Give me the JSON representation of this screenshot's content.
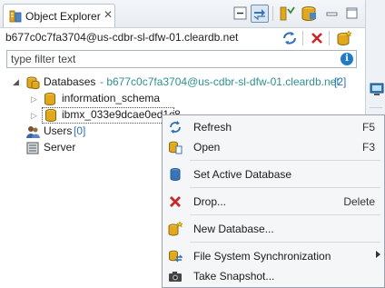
{
  "tab": {
    "title": "Object Explorer",
    "close": "✕"
  },
  "connection": {
    "label": "b677c0c7fa3704@us-cdbr-sl-dfw-01.cleardb.net"
  },
  "filter": {
    "placeholder": "type filter text",
    "info": "i"
  },
  "tree": {
    "databases": {
      "label": "Databases",
      "connection": "- b677c0c7fa3704@us-cdbr-sl-dfw-01.cleardb.net",
      "count": "[2]"
    },
    "schema1": {
      "label": "information_schema"
    },
    "schema2": {
      "label": "ibmx_033e9dcae0ed1c8"
    },
    "users": {
      "label": "Users",
      "count": "[0]"
    },
    "server": {
      "label": "Server"
    }
  },
  "menu": {
    "items": [
      {
        "label": "Refresh",
        "accel": "F5",
        "icon": "refresh-icon"
      },
      {
        "label": "Open",
        "accel": "F3",
        "icon": "open-icon"
      },
      {
        "label": "Set Active Database",
        "accel": "",
        "icon": "database-icon"
      },
      {
        "label": "Drop...",
        "accel": "Delete",
        "icon": "drop-icon"
      },
      {
        "label": "New Database...",
        "accel": "",
        "icon": "new-database-icon"
      },
      {
        "label": "File System Synchronization",
        "accel": "",
        "icon": "sync-icon"
      },
      {
        "label": "Take Snapshot...",
        "accel": "",
        "icon": "camera-icon"
      }
    ]
  },
  "colors": {
    "accent": "#2d6fb8",
    "teal": "#2f8f8f",
    "db_gold": "#e0a81a",
    "drop_red": "#c62828"
  }
}
